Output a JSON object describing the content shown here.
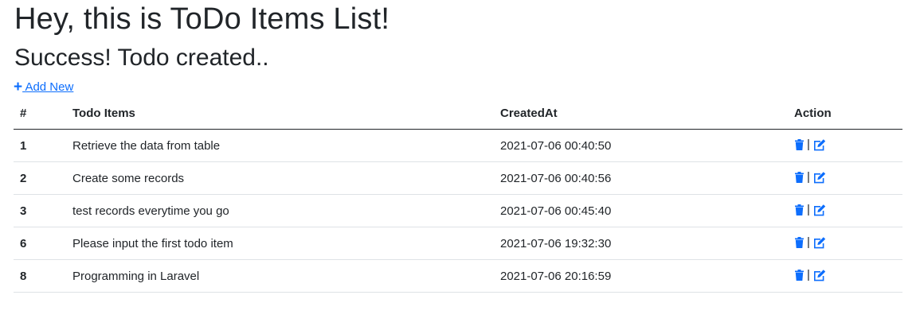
{
  "page": {
    "title": "Hey, this is ToDo Items List!",
    "flash_message": "Success! Todo created..",
    "add_new_label": " Add New",
    "add_new_icon": "plus-icon"
  },
  "table": {
    "headers": {
      "id": "#",
      "item": "Todo Items",
      "created_at": "CreatedAt",
      "action": "Action"
    },
    "rows": [
      {
        "id": "1",
        "item": "Retrieve the data from table",
        "created_at": "2021-07-06 00:40:50"
      },
      {
        "id": "2",
        "item": "Create some records",
        "created_at": "2021-07-06 00:40:56"
      },
      {
        "id": "3",
        "item": "test records everytime you go",
        "created_at": "2021-07-06 00:45:40"
      },
      {
        "id": "6",
        "item": "Please input the first todo item",
        "created_at": "2021-07-06 19:32:30"
      },
      {
        "id": "8",
        "item": "Programming in Laravel",
        "created_at": "2021-07-06 20:16:59"
      }
    ],
    "action_separator": "|",
    "action_icons": [
      "trash-icon",
      "edit-icon"
    ]
  },
  "colors": {
    "link": "#0d6efd",
    "text": "#212529",
    "row_border": "#dee2e6"
  }
}
